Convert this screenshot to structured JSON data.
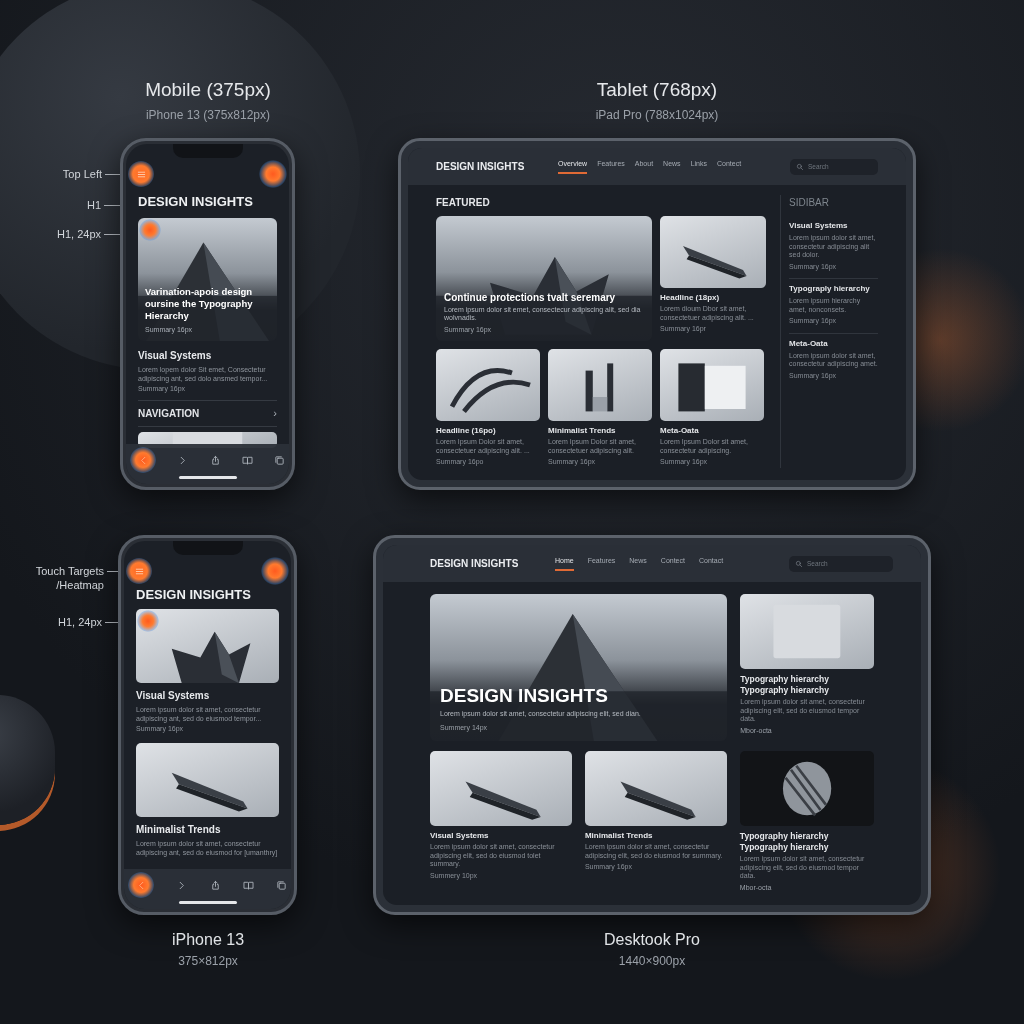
{
  "mobile_top": {
    "title": "Mobile (375px)",
    "subtitle": "iPhone 13 (375x812px)",
    "annotations": [
      "Top Left",
      "H1",
      "H1, 24px"
    ],
    "brand": "DESIGN INSIGHTS",
    "hero": {
      "title": "Varination-apois design oursine the Typography Hierarchy",
      "summary": "Summary 16px"
    },
    "article": {
      "title": "Visual Systems",
      "body": "Lorem lopem dolor Sit emet, Consectetur adipiscing ant, sed dolo ansmed tempor...",
      "summary": "Summary 16px"
    },
    "nav_row": {
      "label": "NAVIGATION",
      "chevron": "›"
    }
  },
  "tablet": {
    "title": "Tablet (768px)",
    "subtitle": "iPad Pro (788x1024px)",
    "brand": "DESIGN INSIGHTS",
    "nav": [
      {
        "label": "Overview",
        "selected": true
      },
      {
        "label": "Features",
        "selected": false
      },
      {
        "label": "About",
        "selected": false
      },
      {
        "label": "News",
        "selected": false
      },
      {
        "label": "Links",
        "selected": false
      },
      {
        "label": "Contect",
        "selected": false
      }
    ],
    "search": {
      "placeholder": "Search"
    },
    "section_title": "FEATURED",
    "hero": {
      "title": "Continue protections tvalt seremary",
      "body": "Lorem ipsum dolor sit emet, consectecur adipiscing alit, sed dia wolvnadis.",
      "summary": "Summary 16px"
    },
    "cards": [
      {
        "title": "Headline (18px)",
        "body": "Lorem dioum Dbor sit amet, consectetuer adipiscing alit. ...",
        "summary": "Summary 16pr"
      },
      {
        "title": "Headline (16po)",
        "body": "Lorem Ipsum Dolor sit amet, consectetuer adipiscing alit. ...",
        "summary": "Summary 16po"
      },
      {
        "title": "Minimalist Trends",
        "body": "Lorem Ipsum Dolor sit amet, consectetuer adipiscing alit.",
        "summary": "Summary 16px"
      },
      {
        "title": "Meta-Oata",
        "body": "Lorem Ipsum Dolor sit amet, consectetur adipiscing.",
        "summary": "Summary 16px"
      }
    ],
    "sidebar": {
      "title": "SIDIBAR",
      "items": [
        {
          "title": "Visual Systems",
          "body": "Lorem ipsum dolor sit amet, consectetur adipiscing alit sed dolor.",
          "summary": "Summary 16px"
        },
        {
          "title": "Typograply hierarchy",
          "body": "Lorem ipsum hierarchy amet, nonconsets.",
          "summary": "Summary 16px"
        },
        {
          "title": "Meta-Oata",
          "body": "Lorem ipsum dolor sit amet, consectetur adipiscing amet.",
          "summary": "Summary 16px"
        }
      ]
    }
  },
  "mobile_bottom": {
    "annotations": [
      "Touch Targets\n/Heatmap",
      "H1, 24px"
    ],
    "brand": "DESIGN INSIGHTS",
    "articles": [
      {
        "title": "Visual Systems",
        "body": "Lorem ipsum dolor sit amet, consectetur adipiscing ant, sed do eiusmod tempor...",
        "summary": "Summary 16px"
      },
      {
        "title": "Minimalist Trends",
        "body": "Lorem ipsum dolor sit amet, consectetur adipiscing ant, sed do eiusmod for [umanthry]"
      }
    ],
    "caption": "iPhone 13",
    "caption_size": "375×812px"
  },
  "desktop": {
    "brand": "DESIGN INSIGHTS",
    "nav": [
      {
        "label": "Home",
        "selected": true
      },
      {
        "label": "Features",
        "selected": false
      },
      {
        "label": "News",
        "selected": false
      },
      {
        "label": "Contect",
        "selected": false
      },
      {
        "label": "Contact",
        "selected": false
      }
    ],
    "search": {
      "placeholder": "Search"
    },
    "hero": {
      "title": "DESIGN INSIGHTS",
      "body": "Lorem ipsum dolor sit amet, consectetur adipiscing elit, sed dian.",
      "summary": "Summery 14px"
    },
    "cards": [
      {
        "title": "Visual Systems",
        "body": "Lorem ipsum dolor sit amet, consectetur adipiscing elit, sed do eiusmod tolet summary.",
        "summary": "Summery 10px"
      },
      {
        "title": "Minimalist Trends",
        "body": "Lorem ipsum dolor sit amet, consectetur adipiscing elit, sed do eiusmod for summary.",
        "summary": "Summary 16px"
      }
    ],
    "side_cards": [
      {
        "title_lines": [
          "Typography hierarchy",
          "Typography hierarchy"
        ],
        "body": "Lorem ipsum dolor sit amet, consectetur adipiscing elit, sed do eiusmod tempor data.",
        "meta": "Mbor-octa"
      },
      {
        "title_lines": [
          "Typography hierarchy",
          "Typography hierarchy"
        ],
        "body": "Lorem ipsum dolor sit amet, consectetur adipiscing elit, sed do eiusmod tempor data.",
        "meta": "Mbor-octa"
      }
    ],
    "caption": "Desktook Pro",
    "caption_size": "1440×900px"
  }
}
